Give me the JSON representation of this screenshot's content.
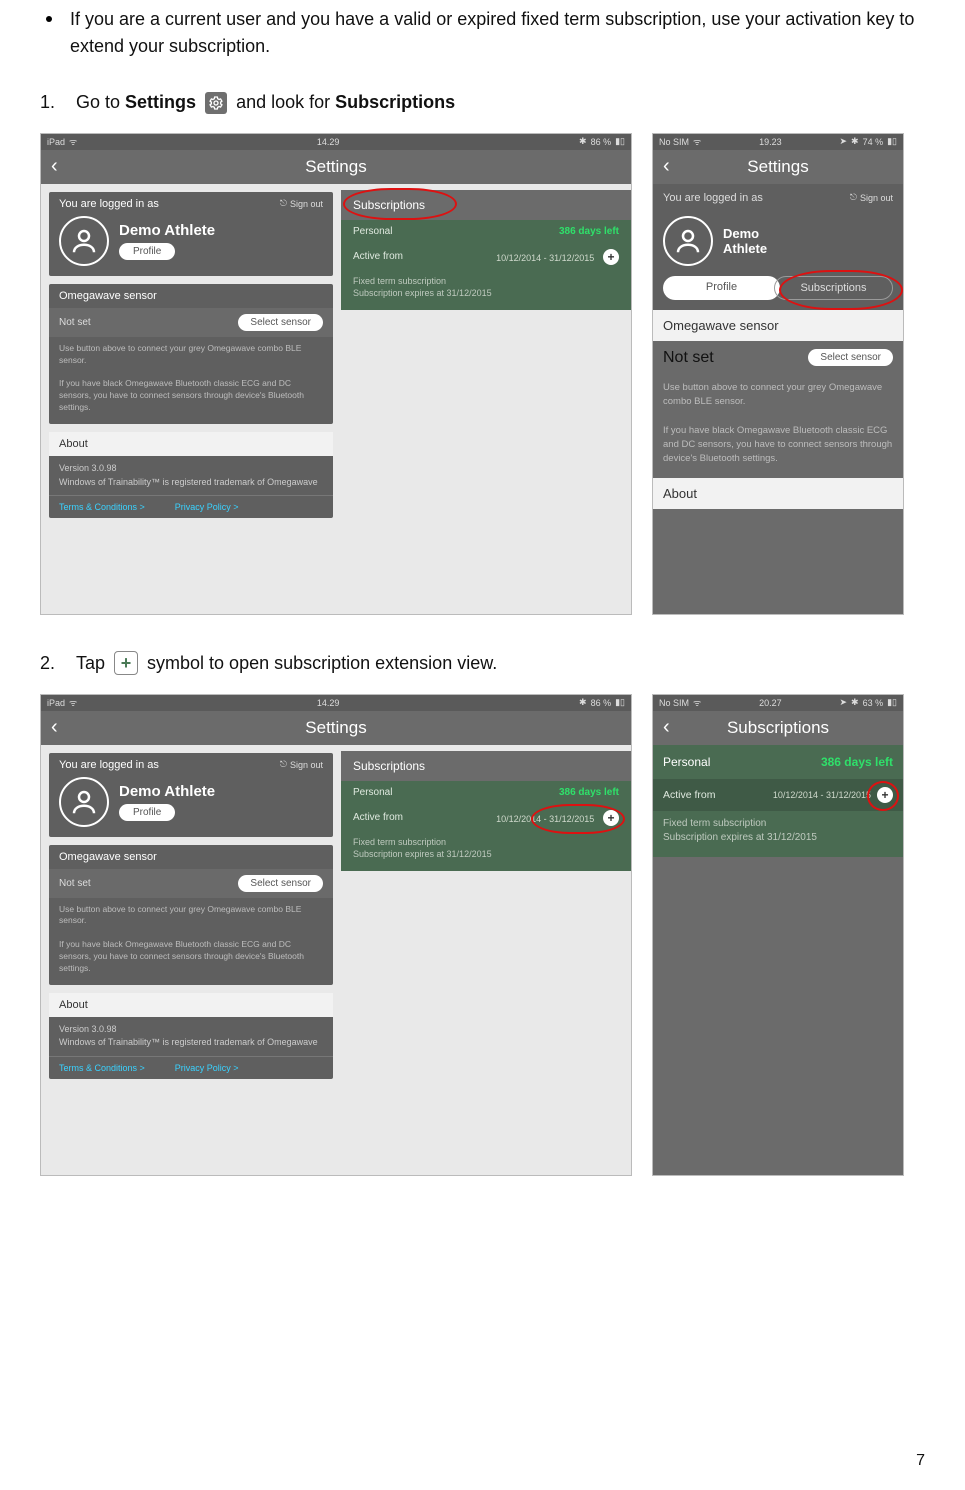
{
  "doc": {
    "bullet_text": "If you are a current user and you have a valid or expired fixed term subscription, use your activation key to extend your subscription.",
    "step1_num": "1.",
    "step1_a": "Go to ",
    "step1_b_bold": "Settings",
    "step1_c": " and look for ",
    "step1_d_bold": "Subscriptions",
    "step2_num": "2.",
    "step2_a": "Tap ",
    "step2_b": " symbol to open subscription extension view.",
    "page_number": "7"
  },
  "status": {
    "ipad_left": "iPad",
    "ipad_time": "14.29",
    "ipad_batt": "86 %",
    "phone1_left": "No SIM",
    "phone1_time": "19.23",
    "phone1_batt": "74 %",
    "phone2_left": "No SIM",
    "phone2_time": "20.27",
    "phone2_batt": "63 %"
  },
  "ui": {
    "settings_title": "Settings",
    "subscriptions_title": "Subscriptions",
    "logged_in_as": "You are logged in as",
    "sign_out": "Sign out",
    "user_name": "Demo Athlete",
    "user_name_line1": "Demo",
    "user_name_line2": "Athlete",
    "profile_btn": "Profile",
    "subscriptions_btn": "Subscriptions",
    "sensor_header": "Omegawave sensor",
    "not_set": "Not set",
    "select_sensor": "Select sensor",
    "sensor_help1": "Use button above to connect your grey Omegawave combo BLE sensor.",
    "sensor_help2": "If you have black Omegawave Bluetooth classic ECG and DC sensors, you have to connect sensors through device's Bluetooth settings.",
    "about_header": "About",
    "version": "Version 3.0.98",
    "trademark": "Windows of Trainability™ is registered trademark of Omegawave",
    "terms": "Terms & Conditions >",
    "privacy": "Privacy Policy >",
    "sub_personal": "Personal",
    "days_left": "386 days left",
    "active_from": "Active from",
    "date_range": "10/12/2014 - 31/12/2015",
    "sub_note1": "Fixed term subscription",
    "sub_note2": "Subscription expires at 31/12/2015"
  }
}
